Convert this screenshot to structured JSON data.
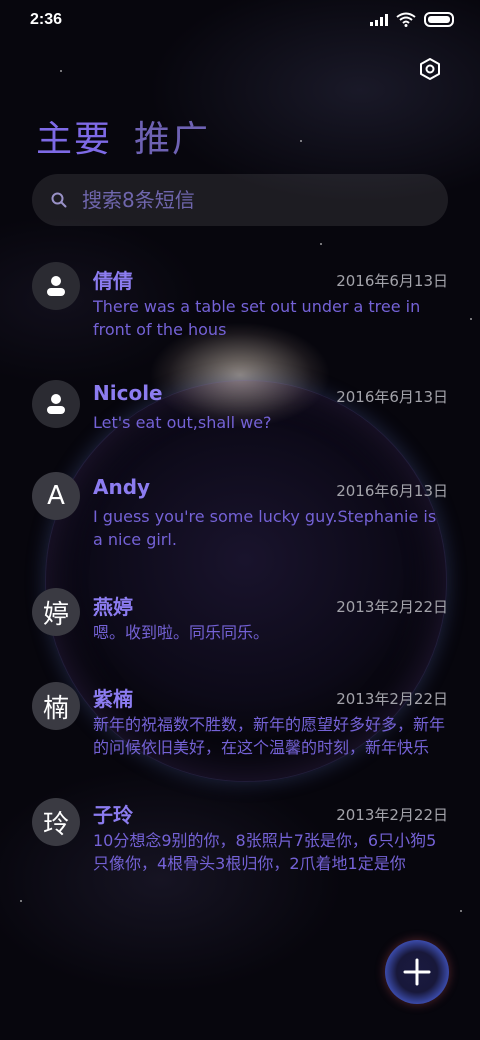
{
  "status_bar": {
    "time": "2:36"
  },
  "tabs": [
    {
      "label": "主要"
    },
    {
      "label": "推广"
    }
  ],
  "search": {
    "placeholder": "搜索8条短信"
  },
  "messages": [
    {
      "name": "倩倩",
      "date": "2016年6月13日",
      "preview": "There was a table set out under a tree in front of the hous",
      "avatar": "person-icon"
    },
    {
      "name": "Nicole",
      "date": "2016年6月13日",
      "preview": "Let's eat out,shall we?",
      "avatar": "person-icon"
    },
    {
      "name": "Andy",
      "date": "2016年6月13日",
      "preview": "I guess you're some lucky guy.Stephanie is a nice girl.",
      "avatar_letter": "A"
    },
    {
      "name": "燕婷",
      "date": "2013年2月22日",
      "preview": "嗯。收到啦。同乐同乐。",
      "avatar_letter": "婷"
    },
    {
      "name": "紫楠",
      "date": "2013年2月22日",
      "preview": "新年的祝福数不胜数，新年的愿望好多好多，新年的问候依旧美好，在这个温馨的时刻，新年快乐",
      "avatar_letter": "楠"
    },
    {
      "name": "子玲",
      "date": "2013年2月22日",
      "preview": "10分想念9别的你，8张照片7张是你，6只小狗5只像你，4根骨头3根归你，2爪着地1定是你",
      "avatar_letter": "玲"
    }
  ],
  "icons": {
    "settings": "hexagon-settings-icon",
    "search": "search-icon",
    "compose": "plus-icon"
  },
  "colors": {
    "accent": "#8c7cf0",
    "preview_text": "#7462d6",
    "date_text": "#a3a3aa"
  }
}
